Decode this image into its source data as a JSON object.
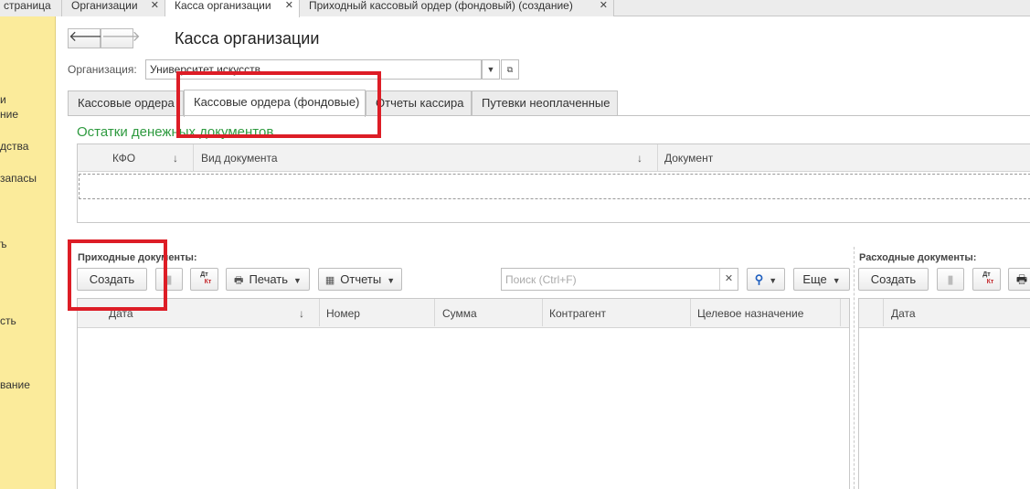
{
  "top_tabs": [
    {
      "label": "страница",
      "closable": false
    },
    {
      "label": "Организации",
      "closable": true
    },
    {
      "label": "Касса организации",
      "closable": true,
      "active": true
    },
    {
      "label": "Приходный кассовый ордер (фондовый) (создание)",
      "closable": true
    }
  ],
  "left_panel": {
    "items": [
      "и",
      "ние",
      "дства",
      "запасы",
      "ъ",
      "сть",
      "вание"
    ]
  },
  "page": {
    "title": "Касса организации",
    "back_icon": "arrow-left-icon",
    "forward_icon": "arrow-right-icon"
  },
  "org": {
    "label": "Организация:",
    "value": "Университет искусств"
  },
  "main_tabs": [
    {
      "label": "Кассовые ордера"
    },
    {
      "label": "Кассовые ордера (фондовые)",
      "active": true
    },
    {
      "label": "Отчеты кассира"
    },
    {
      "label": "Путевки неоплаченные"
    }
  ],
  "balances": {
    "title": "Остатки денежных документов",
    "columns": [
      "КФО",
      "Вид документа",
      "Документ"
    ]
  },
  "incoming": {
    "label": "Приходные документы:",
    "create": "Создать",
    "print": "Печать",
    "reports": "Отчеты",
    "search_placeholder": "Поиск (Ctrl+F)",
    "more": "Еще",
    "dtkt_dt": "Дт",
    "dtkt_kt": "Кт",
    "columns": [
      "Дата",
      "Номер",
      "Сумма",
      "Контрагент",
      "Целевое назначение"
    ]
  },
  "outgoing": {
    "label": "Расходные документы:",
    "create": "Создать",
    "columns": [
      "Дата"
    ]
  },
  "colors": {
    "highlight": "#dd1d26",
    "section_title": "#2e9a3f",
    "side_panel": "#fbeb9b"
  }
}
